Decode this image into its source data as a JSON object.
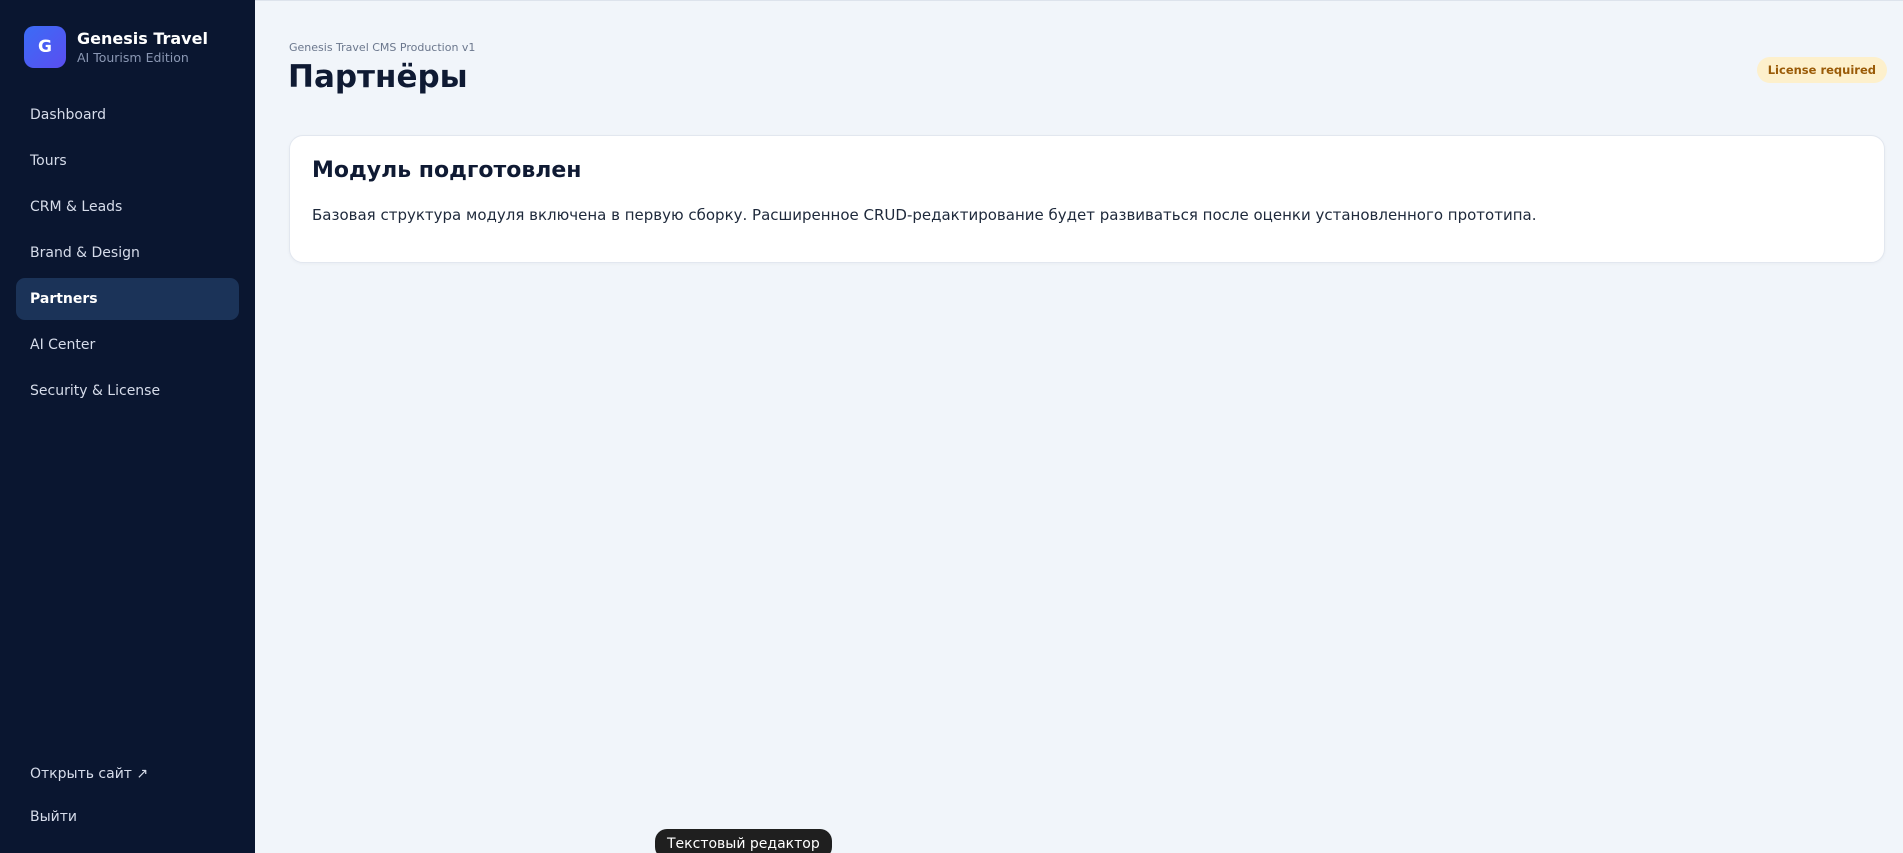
{
  "brand": {
    "logo_letter": "G",
    "title": "Genesis Travel",
    "subtitle": "AI Tourism Edition",
    "accent_color": "#4c5cf4"
  },
  "sidebar": {
    "items": [
      {
        "label": "Dashboard",
        "active": false
      },
      {
        "label": "Tours",
        "active": false
      },
      {
        "label": "CRM & Leads",
        "active": false
      },
      {
        "label": "Brand & Design",
        "active": false
      },
      {
        "label": "Partners",
        "active": true
      },
      {
        "label": "AI Center",
        "active": false
      },
      {
        "label": "Security & License",
        "active": false
      }
    ],
    "bottom": {
      "open_site": "Открыть сайт ↗",
      "logout": "Выйти"
    }
  },
  "header": {
    "breadcrumb": "Genesis Travel CMS Production v1",
    "title": "Партнёры",
    "license_badge": "License required"
  },
  "card": {
    "title": "Модуль подготовлен",
    "text": "Базовая структура модуля включена в первую сборку. Расширенное CRUD-редактирование будет развиваться после оценки установленного прототипа."
  },
  "tooltip": {
    "text": "Текстовый редактор"
  },
  "colors": {
    "sidebar_bg": "#0a1630",
    "active_item_bg": "#1b3358",
    "page_bg": "#f1f5fa",
    "badge_bg": "#fdf0cc",
    "badge_text": "#9a5b08"
  }
}
